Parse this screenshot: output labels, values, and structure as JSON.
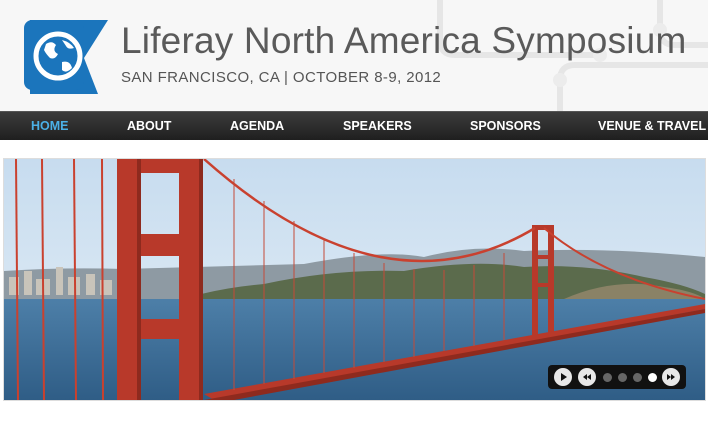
{
  "site": {
    "title": "Liferay North America Symposium",
    "subtitle": "SAN FRANCISCO, CA | OCTOBER 8-9, 2012"
  },
  "nav": {
    "items": [
      {
        "label": "HOME",
        "active": true
      },
      {
        "label": "ABOUT",
        "active": false
      },
      {
        "label": "AGENDA",
        "active": false
      },
      {
        "label": "SPEAKERS",
        "active": false
      },
      {
        "label": "SPONSORS",
        "active": false
      },
      {
        "label": "VENUE & TRAVEL",
        "active": false
      }
    ]
  },
  "slideshow": {
    "slide_count": 5,
    "active_slide": 4
  },
  "colors": {
    "accent": "#4bb0e6",
    "logo_blue": "#1b75bc",
    "nav_bg": "#2a2a2a",
    "bridge": "#b8392a"
  },
  "icons": [
    "globe-icon",
    "play-icon",
    "prev-icon",
    "next-icon"
  ]
}
